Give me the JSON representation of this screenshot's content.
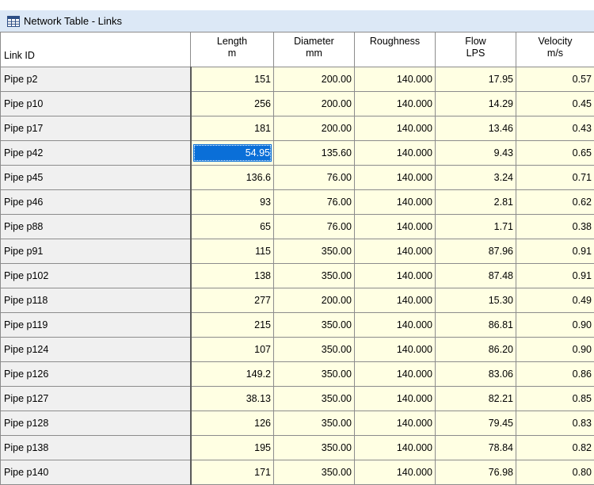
{
  "window": {
    "title": "Network Table - Links"
  },
  "columns": [
    {
      "label": "Link ID",
      "unit": ""
    },
    {
      "label": "Length",
      "unit": "m"
    },
    {
      "label": "Diameter",
      "unit": "mm"
    },
    {
      "label": "Roughness",
      "unit": ""
    },
    {
      "label": "Flow",
      "unit": "LPS"
    },
    {
      "label": "Velocity",
      "unit": "m/s"
    }
  ],
  "selected_cell": {
    "row": 3,
    "column": "length"
  },
  "rows": [
    {
      "id": "Pipe p2",
      "length": "151",
      "diameter": "200.00",
      "roughness": "140.000",
      "flow": "17.95",
      "velocity": "0.57"
    },
    {
      "id": "Pipe p10",
      "length": "256",
      "diameter": "200.00",
      "roughness": "140.000",
      "flow": "14.29",
      "velocity": "0.45"
    },
    {
      "id": "Pipe p17",
      "length": "181",
      "diameter": "200.00",
      "roughness": "140.000",
      "flow": "13.46",
      "velocity": "0.43"
    },
    {
      "id": "Pipe p42",
      "length": "54.95",
      "diameter": "135.60",
      "roughness": "140.000",
      "flow": "9.43",
      "velocity": "0.65"
    },
    {
      "id": "Pipe p45",
      "length": "136.6",
      "diameter": "76.00",
      "roughness": "140.000",
      "flow": "3.24",
      "velocity": "0.71"
    },
    {
      "id": "Pipe p46",
      "length": "93",
      "diameter": "76.00",
      "roughness": "140.000",
      "flow": "2.81",
      "velocity": "0.62"
    },
    {
      "id": "Pipe p88",
      "length": "65",
      "diameter": "76.00",
      "roughness": "140.000",
      "flow": "1.71",
      "velocity": "0.38"
    },
    {
      "id": "Pipe p91",
      "length": "115",
      "diameter": "350.00",
      "roughness": "140.000",
      "flow": "87.96",
      "velocity": "0.91"
    },
    {
      "id": "Pipe p102",
      "length": "138",
      "diameter": "350.00",
      "roughness": "140.000",
      "flow": "87.48",
      "velocity": "0.91"
    },
    {
      "id": "Pipe p118",
      "length": "277",
      "diameter": "200.00",
      "roughness": "140.000",
      "flow": "15.30",
      "velocity": "0.49"
    },
    {
      "id": "Pipe p119",
      "length": "215",
      "diameter": "350.00",
      "roughness": "140.000",
      "flow": "86.81",
      "velocity": "0.90"
    },
    {
      "id": "Pipe p124",
      "length": "107",
      "diameter": "350.00",
      "roughness": "140.000",
      "flow": "86.20",
      "velocity": "0.90"
    },
    {
      "id": "Pipe p126",
      "length": "149.2",
      "diameter": "350.00",
      "roughness": "140.000",
      "flow": "83.06",
      "velocity": "0.86"
    },
    {
      "id": "Pipe p127",
      "length": "38.13",
      "diameter": "350.00",
      "roughness": "140.000",
      "flow": "82.21",
      "velocity": "0.85"
    },
    {
      "id": "Pipe p128",
      "length": "126",
      "diameter": "350.00",
      "roughness": "140.000",
      "flow": "79.45",
      "velocity": "0.83"
    },
    {
      "id": "Pipe p138",
      "length": "195",
      "diameter": "350.00",
      "roughness": "140.000",
      "flow": "78.84",
      "velocity": "0.82"
    },
    {
      "id": "Pipe p140",
      "length": "171",
      "diameter": "350.00",
      "roughness": "140.000",
      "flow": "76.98",
      "velocity": "0.80"
    }
  ],
  "colors": {
    "titlebar": "#dce8f6",
    "data_cell": "#ffffe3",
    "id_cell": "#f0f0f0",
    "selection": "#0a6fd8"
  },
  "icons": {
    "title": "table-icon"
  }
}
